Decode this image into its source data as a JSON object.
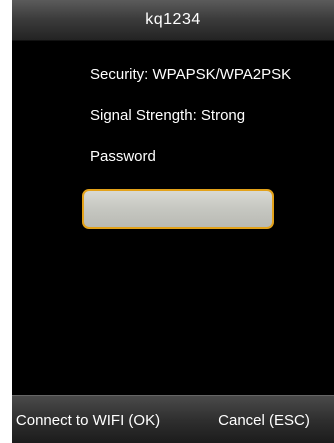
{
  "window": {
    "title": "kq1234"
  },
  "info": {
    "security": "Security:  WPAPSK/WPA2PSK",
    "signal": "Signal Strength:  Strong",
    "password_label": "Password"
  },
  "password_field": {
    "value": ""
  },
  "footer": {
    "connect_label": "Connect to WIFI (OK)",
    "cancel_label": "Cancel (ESC)"
  },
  "colors": {
    "focus_border": "#e3a21a",
    "background": "#000000",
    "text": "#ffffff"
  }
}
